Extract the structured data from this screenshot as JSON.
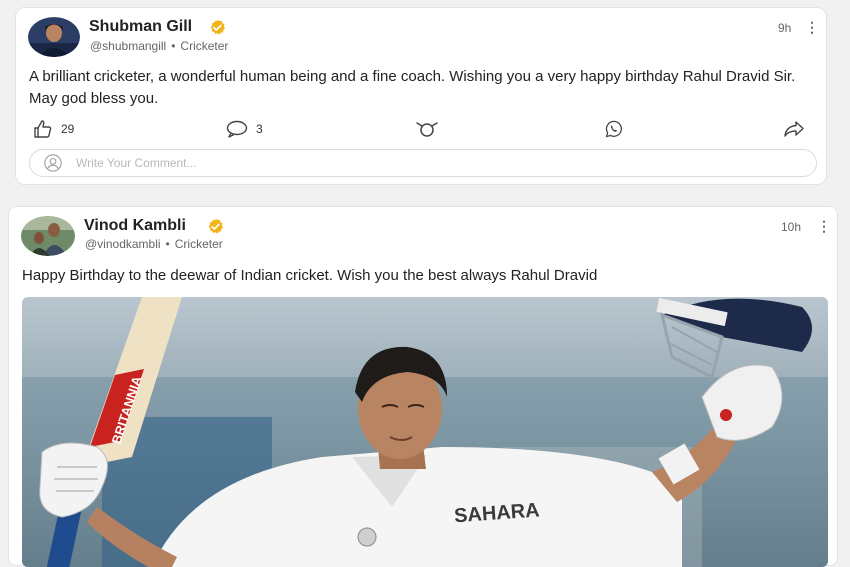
{
  "posts": [
    {
      "author": "Shubman Gill",
      "handle": "@shubmangill",
      "role": "Cricketer",
      "time": "9h",
      "text": "A brilliant cricketer, a wonderful human being and a fine coach. Wishing you a very happy birthday Rahul Dravid Sir. May god bless you.",
      "likes": "29",
      "comments": "3",
      "comment_placeholder": "Write Your Comment..."
    },
    {
      "author": "Vinod Kambli",
      "handle": "@vinodkambli",
      "role": "Cricketer",
      "time": "10h",
      "text": "Happy Birthday to the deewar of Indian cricket. Wish you the best always Rahul Dravid",
      "photo_texts": {
        "bat_brand": "BRITANNIA",
        "shirt_sponsor": "SAHARA"
      }
    }
  ],
  "colors": {
    "verified": "#f2b418",
    "accent": "#444444"
  },
  "icons": [
    "verified-badge-icon",
    "thumbs-up-icon",
    "comment-icon",
    "reaction-icon",
    "whatsapp-icon",
    "share-icon",
    "user-icon",
    "more-icon"
  ]
}
